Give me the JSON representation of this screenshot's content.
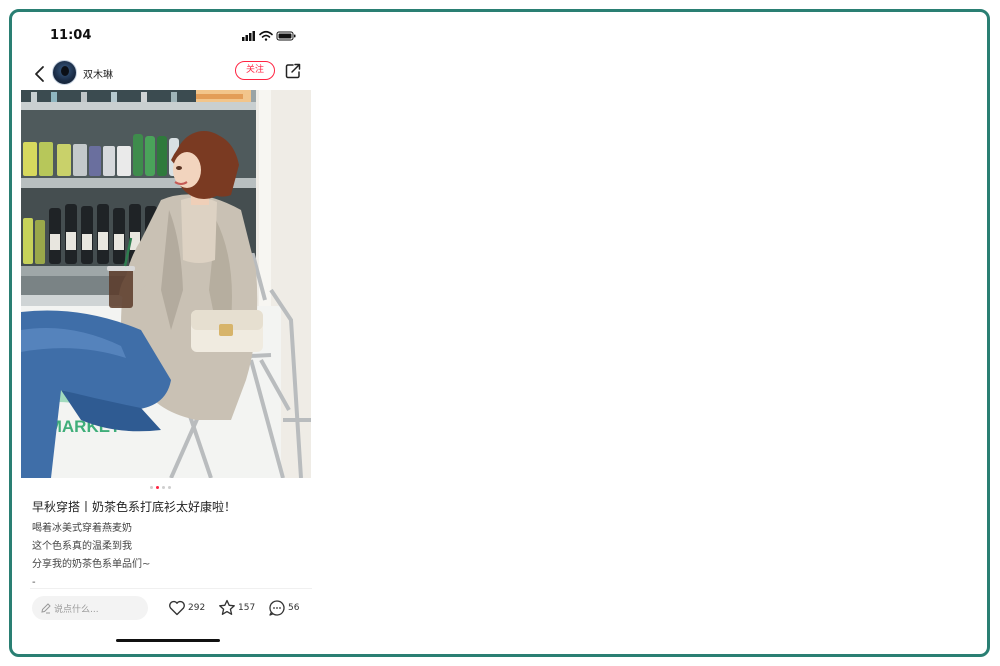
{
  "status_bar": {
    "time": "11:04",
    "icons": [
      "signal-icon",
      "wifi-icon",
      "battery-icon"
    ]
  },
  "header": {
    "back_icon": "chevron-left-icon",
    "username": "双木琳",
    "follow_label": "关注",
    "share_icon": "share-icon"
  },
  "post": {
    "image_count": 4,
    "current_image": 1,
    "title": "早秋穿搭丨奶茶色系打底衫太好康啦！",
    "description": [
      "喝着冰美式穿着燕麦奶",
      "这个色系真的温柔到我",
      "分享我的奶茶色系单品们~",
      "-"
    ],
    "photo_sign_text": "IMARKET"
  },
  "bottom_bar": {
    "comment_placeholder": "说点什么...",
    "likes": "292",
    "collects": "157",
    "comments": "56"
  },
  "colors": {
    "frame_border": "#2a7f73",
    "accent": "#ff2442"
  }
}
